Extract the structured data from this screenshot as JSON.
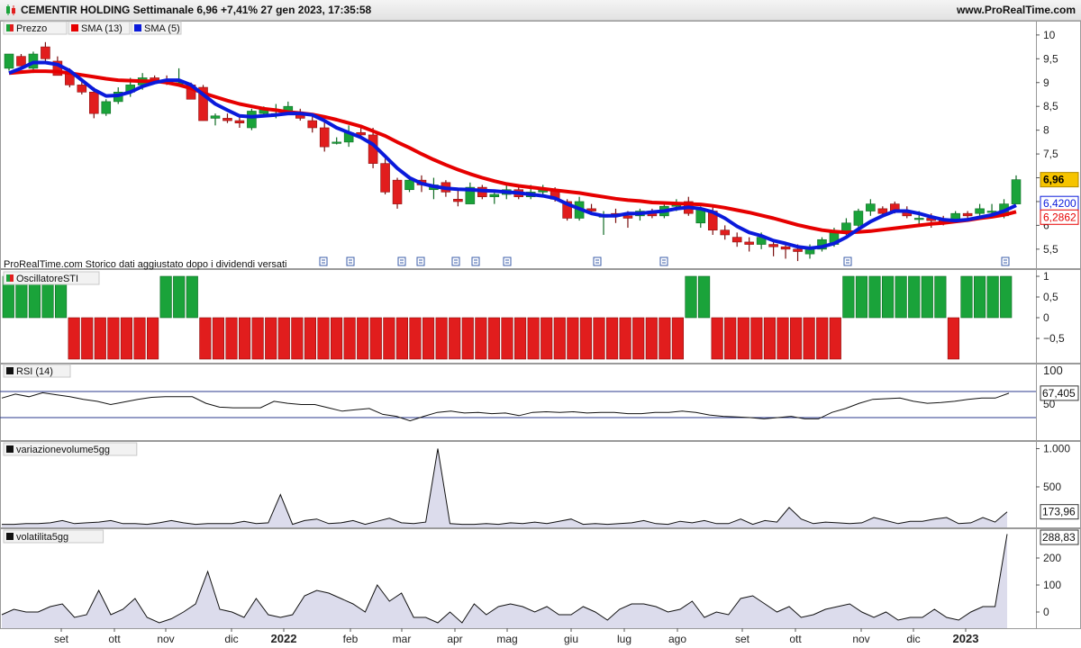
{
  "header": {
    "title": "CEMENTIR HOLDING Settimanale 6,96 +7,41% 27 gen 2023, 17:35:58",
    "site": "www.ProRealTime.com"
  },
  "colors": {
    "up": "#1aa33a",
    "down": "#e11d1d",
    "sma13": "#e60000",
    "sma5": "#0a1adb",
    "line": "#111111",
    "fill": "#dcdcec",
    "rsi_band": "#2b3a8c"
  },
  "panels": {
    "price": {
      "legend": [
        "Prezzo",
        "SMA (13)",
        "SMA (5)"
      ],
      "note": "ProRealTime.com  Storico dati aggiustato dopo i dividendi versati",
      "y_ticks": [
        "10",
        "9,5",
        "9",
        "8,5",
        "8",
        "7,5",
        "7",
        "6,5",
        "6",
        "5,5"
      ],
      "last_price": "6,96",
      "sma5_last": "6,4200",
      "sma13_last": "6,2862"
    },
    "oscillator": {
      "legend": "OscillatoreSTI",
      "y_ticks": [
        "1",
        "0,5",
        "0",
        "−0,5"
      ]
    },
    "rsi": {
      "legend": "RSI (14)",
      "y_ticks": [
        "100",
        "50"
      ],
      "last": "67,405"
    },
    "volume": {
      "legend": "variazionevolume5gg",
      "y_ticks": [
        "1.000",
        "500"
      ],
      "last": "173,96"
    },
    "volatility": {
      "legend": "volatilita5gg",
      "y_ticks": [
        "200",
        "100",
        "0"
      ],
      "last": "288,83"
    }
  },
  "x_axis_labels": [
    "set",
    "ott",
    "nov",
    "dic",
    "2022",
    "feb",
    "mar",
    "apr",
    "mag",
    "giu",
    "lug",
    "ago",
    "set",
    "ott",
    "nov",
    "dic",
    "2023"
  ],
  "chart_data": [
    {
      "type": "candlestick",
      "title": "CEMENTIR HOLDING Settimanale",
      "ylim": [
        5.1,
        10.3
      ],
      "series": [
        {
          "name": "Prezzo",
          "ohlc": [
            [
              9.3,
              9.6,
              9.25,
              9.6
            ],
            [
              9.55,
              9.6,
              9.35,
              9.35
            ],
            [
              9.3,
              9.65,
              9.2,
              9.6
            ],
            [
              9.75,
              9.85,
              9.45,
              9.5
            ],
            [
              9.45,
              9.55,
              9.15,
              9.15
            ],
            [
              9.2,
              9.3,
              8.9,
              8.95
            ],
            [
              8.95,
              9.05,
              8.75,
              8.8
            ],
            [
              8.8,
              8.9,
              8.25,
              8.35
            ],
            [
              8.35,
              8.65,
              8.3,
              8.6
            ],
            [
              8.6,
              8.9,
              8.55,
              8.8
            ],
            [
              8.8,
              9.1,
              8.7,
              8.95
            ],
            [
              8.95,
              9.2,
              8.85,
              9.1
            ],
            [
              9.1,
              9.15,
              9.0,
              9.05
            ],
            [
              9.05,
              9.15,
              8.95,
              9.0
            ],
            [
              9.0,
              9.3,
              8.95,
              9.0
            ],
            [
              8.95,
              9.0,
              8.65,
              8.65
            ],
            [
              8.9,
              8.95,
              8.2,
              8.2
            ],
            [
              8.25,
              8.35,
              8.1,
              8.3
            ],
            [
              8.25,
              8.35,
              8.15,
              8.2
            ],
            [
              8.2,
              8.3,
              8.05,
              8.15
            ],
            [
              8.05,
              8.45,
              8.0,
              8.4
            ],
            [
              8.35,
              8.5,
              8.3,
              8.45
            ],
            [
              8.35,
              8.55,
              8.25,
              8.35
            ],
            [
              8.4,
              8.6,
              8.35,
              8.5
            ],
            [
              8.35,
              8.45,
              8.2,
              8.25
            ],
            [
              8.2,
              8.3,
              7.95,
              8.05
            ],
            [
              8.05,
              8.2,
              7.55,
              7.65
            ],
            [
              7.75,
              7.85,
              7.7,
              7.75
            ],
            [
              7.75,
              8.1,
              7.65,
              7.95
            ],
            [
              7.95,
              8.05,
              7.85,
              7.9
            ],
            [
              7.9,
              8.05,
              7.2,
              7.3
            ],
            [
              7.3,
              7.4,
              6.65,
              6.7
            ],
            [
              6.95,
              7.0,
              6.35,
              6.45
            ],
            [
              6.75,
              7.05,
              6.7,
              6.95
            ],
            [
              6.95,
              7.05,
              6.7,
              6.85
            ],
            [
              6.75,
              7.0,
              6.55,
              6.85
            ],
            [
              6.9,
              6.95,
              6.6,
              6.7
            ],
            [
              6.55,
              6.75,
              6.4,
              6.5
            ],
            [
              6.45,
              6.9,
              6.45,
              6.8
            ],
            [
              6.8,
              6.85,
              6.55,
              6.6
            ],
            [
              6.6,
              6.75,
              6.45,
              6.65
            ],
            [
              6.65,
              6.85,
              6.55,
              6.75
            ],
            [
              6.75,
              6.8,
              6.55,
              6.6
            ],
            [
              6.6,
              6.85,
              6.55,
              6.7
            ],
            [
              6.7,
              6.85,
              6.6,
              6.75
            ],
            [
              6.75,
              6.8,
              6.5,
              6.55
            ],
            [
              6.5,
              6.55,
              6.1,
              6.15
            ],
            [
              6.15,
              6.6,
              6.1,
              6.5
            ],
            [
              6.35,
              6.45,
              6.25,
              6.3
            ],
            [
              6.2,
              6.3,
              5.8,
              6.2
            ],
            [
              6.25,
              6.35,
              6.05,
              6.2
            ],
            [
              6.2,
              6.3,
              5.95,
              6.15
            ],
            [
              6.2,
              6.35,
              6.1,
              6.3
            ],
            [
              6.3,
              6.35,
              6.15,
              6.2
            ],
            [
              6.2,
              6.5,
              6.15,
              6.4
            ],
            [
              6.4,
              6.55,
              6.3,
              6.45
            ],
            [
              6.5,
              6.6,
              6.2,
              6.25
            ],
            [
              6.05,
              6.4,
              5.95,
              6.35
            ],
            [
              6.3,
              6.4,
              5.8,
              5.9
            ],
            [
              5.9,
              6.0,
              5.7,
              5.8
            ],
            [
              5.75,
              5.85,
              5.55,
              5.65
            ],
            [
              5.65,
              5.75,
              5.45,
              5.6
            ],
            [
              5.6,
              5.85,
              5.5,
              5.75
            ],
            [
              5.6,
              5.7,
              5.35,
              5.55
            ],
            [
              5.55,
              5.6,
              5.3,
              5.5
            ],
            [
              5.5,
              5.6,
              5.25,
              5.45
            ],
            [
              5.4,
              5.6,
              5.3,
              5.55
            ],
            [
              5.5,
              5.75,
              5.45,
              5.7
            ],
            [
              5.6,
              5.95,
              5.55,
              5.85
            ],
            [
              5.85,
              6.15,
              5.8,
              6.05
            ],
            [
              6.0,
              6.35,
              5.95,
              6.3
            ],
            [
              6.3,
              6.55,
              6.2,
              6.45
            ],
            [
              6.35,
              6.4,
              6.2,
              6.25
            ],
            [
              6.45,
              6.5,
              6.25,
              6.3
            ],
            [
              6.3,
              6.4,
              6.15,
              6.2
            ],
            [
              6.15,
              6.3,
              6.0,
              6.15
            ],
            [
              6.15,
              6.25,
              5.95,
              6.1
            ],
            [
              6.1,
              6.2,
              6.0,
              6.05
            ],
            [
              6.1,
              6.3,
              6.05,
              6.25
            ],
            [
              6.25,
              6.3,
              6.1,
              6.2
            ],
            [
              6.25,
              6.45,
              6.2,
              6.35
            ],
            [
              6.3,
              6.45,
              6.2,
              6.3
            ],
            [
              6.2,
              6.55,
              6.15,
              6.45
            ],
            [
              6.45,
              7.05,
              6.45,
              6.96
            ]
          ]
        },
        {
          "name": "SMA (13)",
          "values": [
            9.2,
            9.22,
            9.24,
            9.24,
            9.23,
            9.2,
            9.16,
            9.12,
            9.08,
            9.05,
            9.04,
            9.03,
            9.03,
            9.0,
            8.95,
            8.88,
            8.78,
            8.7,
            8.62,
            8.55,
            8.5,
            8.45,
            8.42,
            8.38,
            8.36,
            8.33,
            8.28,
            8.22,
            8.15,
            8.08,
            7.98,
            7.88,
            7.75,
            7.63,
            7.5,
            7.38,
            7.27,
            7.17,
            7.08,
            7.0,
            6.93,
            6.87,
            6.83,
            6.8,
            6.77,
            6.74,
            6.71,
            6.68,
            6.64,
            6.6,
            6.56,
            6.53,
            6.51,
            6.48,
            6.47,
            6.46,
            6.45,
            6.44,
            6.41,
            6.37,
            6.32,
            6.27,
            6.21,
            6.15,
            6.08,
            6.01,
            5.95,
            5.9,
            5.87,
            5.85,
            5.86,
            5.88,
            5.91,
            5.94,
            5.97,
            6.0,
            6.03,
            6.05,
            6.08,
            6.11,
            6.15,
            6.18,
            6.22,
            6.2862
          ]
        },
        {
          "name": "SMA (5)",
          "values": [
            9.2,
            9.3,
            9.42,
            9.42,
            9.38,
            9.25,
            9.05,
            8.85,
            8.72,
            8.73,
            8.8,
            8.92,
            9.0,
            9.05,
            9.05,
            8.95,
            8.75,
            8.55,
            8.42,
            8.3,
            8.28,
            8.3,
            8.32,
            8.35,
            8.35,
            8.32,
            8.2,
            8.05,
            7.95,
            7.85,
            7.7,
            7.45,
            7.2,
            7.0,
            6.88,
            6.82,
            6.78,
            6.76,
            6.75,
            6.73,
            6.72,
            6.7,
            6.68,
            6.65,
            6.62,
            6.57,
            6.45,
            6.35,
            6.25,
            6.2,
            6.2,
            6.25,
            6.25,
            6.28,
            6.3,
            6.35,
            6.38,
            6.35,
            6.28,
            6.15,
            5.98,
            5.85,
            5.78,
            5.68,
            5.62,
            5.55,
            5.52,
            5.55,
            5.62,
            5.75,
            5.92,
            6.08,
            6.2,
            6.3,
            6.3,
            6.25,
            6.18,
            6.12,
            6.1,
            6.12,
            6.17,
            6.22,
            6.3,
            6.42
          ]
        }
      ]
    },
    {
      "type": "bar",
      "title": "OscillatoreSTI",
      "ylim": [
        -1,
        1
      ],
      "values": [
        1,
        1,
        1,
        1,
        1,
        -1,
        -1,
        -1,
        -1,
        -1,
        -1,
        -1,
        1,
        1,
        1,
        -1,
        -1,
        -1,
        -1,
        -1,
        -1,
        -1,
        -1,
        -1,
        -1,
        -1,
        -1,
        -1,
        -1,
        -1,
        -1,
        -1,
        -1,
        -1,
        -1,
        -1,
        -1,
        -1,
        -1,
        -1,
        -1,
        -1,
        -1,
        -1,
        -1,
        -1,
        -1,
        -1,
        -1,
        -1,
        -1,
        -1,
        1,
        1,
        -1,
        -1,
        -1,
        -1,
        -1,
        -1,
        -1,
        -1,
        -1,
        -1,
        1,
        1,
        1,
        1,
        1,
        1,
        1,
        1,
        -1,
        1,
        1,
        1,
        1
      ]
    },
    {
      "type": "line",
      "title": "RSI (14)",
      "ylim": [
        0,
        100
      ],
      "bands": [
        70,
        30
      ],
      "values": [
        60,
        66,
        62,
        68,
        65,
        62,
        58,
        55,
        50,
        54,
        58,
        61,
        62,
        62,
        62,
        52,
        46,
        45,
        45,
        45,
        55,
        52,
        50,
        50,
        45,
        40,
        42,
        44,
        35,
        32,
        25,
        32,
        38,
        40,
        37,
        38,
        36,
        37,
        33,
        38,
        39,
        38,
        39,
        37,
        38,
        38,
        36,
        36,
        38,
        38,
        40,
        38,
        34,
        32,
        31,
        30,
        28,
        30,
        32,
        28,
        28,
        38,
        44,
        52,
        58,
        59,
        60,
        55,
        52,
        53,
        55,
        58,
        60,
        60,
        67.405
      ]
    },
    {
      "type": "area",
      "title": "variazionevolume5gg",
      "ylim": [
        -30,
        1100
      ],
      "values": [
        10,
        10,
        20,
        20,
        30,
        60,
        20,
        30,
        40,
        60,
        20,
        20,
        10,
        30,
        60,
        30,
        10,
        20,
        20,
        20,
        50,
        20,
        30,
        400,
        10,
        60,
        80,
        20,
        30,
        60,
        10,
        50,
        90,
        30,
        20,
        40,
        1000,
        20,
        10,
        10,
        20,
        10,
        30,
        20,
        40,
        20,
        50,
        80,
        10,
        20,
        10,
        20,
        30,
        60,
        20,
        10,
        50,
        30,
        60,
        20,
        20,
        80,
        10,
        60,
        40,
        230,
        80,
        20,
        40,
        30,
        20,
        30,
        100,
        60,
        20,
        50,
        50,
        80,
        100,
        20,
        30,
        100,
        40,
        173.96
      ]
    },
    {
      "type": "area",
      "title": "volatilita5gg",
      "ylim": [
        -60,
        310
      ],
      "values": [
        -10,
        10,
        0,
        0,
        20,
        30,
        -20,
        -10,
        80,
        -10,
        10,
        50,
        -20,
        -40,
        -25,
        0,
        30,
        150,
        10,
        0,
        -20,
        50,
        -10,
        -20,
        -10,
        60,
        80,
        70,
        50,
        30,
        0,
        100,
        40,
        70,
        -20,
        -20,
        -40,
        0,
        -40,
        30,
        -10,
        20,
        30,
        20,
        0,
        20,
        -10,
        -10,
        20,
        0,
        -30,
        10,
        30,
        30,
        20,
        0,
        10,
        40,
        -20,
        0,
        -10,
        50,
        60,
        30,
        0,
        20,
        -20,
        -10,
        10,
        20,
        30,
        0,
        -20,
        0,
        -30,
        -20,
        -20,
        10,
        -20,
        -30,
        0,
        20,
        20,
        288.83
      ]
    }
  ]
}
